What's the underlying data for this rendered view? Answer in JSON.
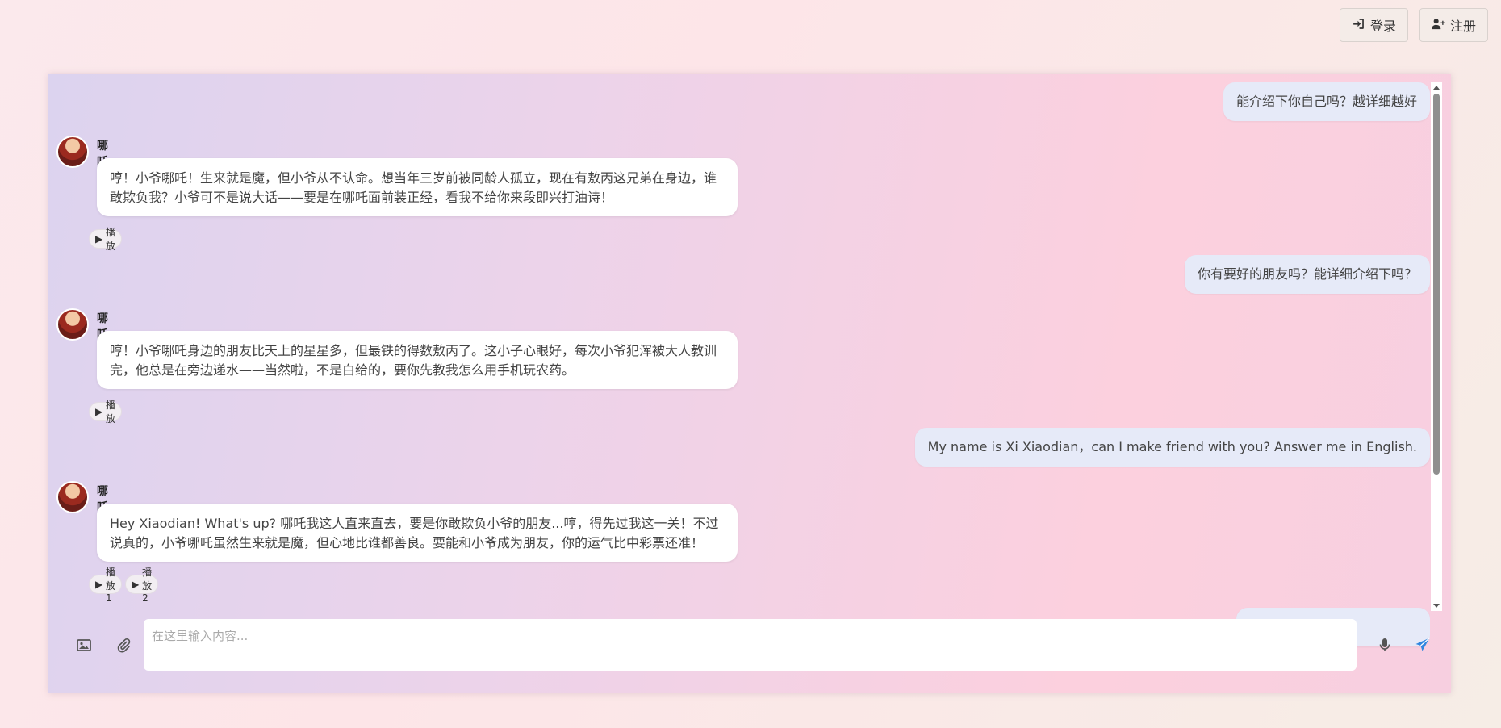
{
  "auth": {
    "login_label": "登录",
    "register_label": "注册"
  },
  "messages": [
    {
      "role": "user",
      "text": "能介绍下你自己吗？越详细越好"
    },
    {
      "role": "bot",
      "name": "哪吒",
      "text": "哼！小爷哪吒！生来就是魔，但小爷从不认命。想当年三岁前被同龄人孤立，现在有敖丙这兄弟在身边，谁敢欺负我？小爷可不是说大话——要是在哪吒面前装正经，看我不给你来段即兴打油诗！",
      "play": [
        "播放"
      ]
    },
    {
      "role": "user",
      "text": "你有要好的朋友吗？能详细介绍下吗？"
    },
    {
      "role": "bot",
      "name": "哪吒",
      "text": "哼！小爷哪吒身边的朋友比天上的星星多，但最铁的得数敖丙了。这小子心眼好，每次小爷犯浑被大人教训完，他总是在旁边递水——当然啦，不是白给的，要你先教我怎么用手机玩农药。",
      "play": [
        "播放"
      ]
    },
    {
      "role": "user",
      "text": "My name is Xi Xiaodian，can I make friend with you?  Answer me in English."
    },
    {
      "role": "bot",
      "name": "哪吒",
      "text": "Hey Xiaodian! What's up? 哪吒我这人直来直去，要是你敢欺负小爷的朋友...哼，得先过我这一关！不过说真的，小爷哪吒虽然生来就是魔，但心地比谁都善良。要能和小爷成为朋友，你的运气比中彩票还准！",
      "play": [
        "播放1",
        "播放2"
      ]
    }
  ],
  "input": {
    "placeholder": "在这里输入内容..."
  },
  "icons": {
    "login": "sign-in-icon",
    "register": "user-plus-icon",
    "image": "image-icon",
    "attach": "paperclip-icon",
    "mic": "microphone-icon",
    "send": "paper-plane-icon"
  },
  "colors": {
    "send": "#2f86e0",
    "user_bubble": "#e6eaf8",
    "bot_bubble": "#ffffff"
  }
}
